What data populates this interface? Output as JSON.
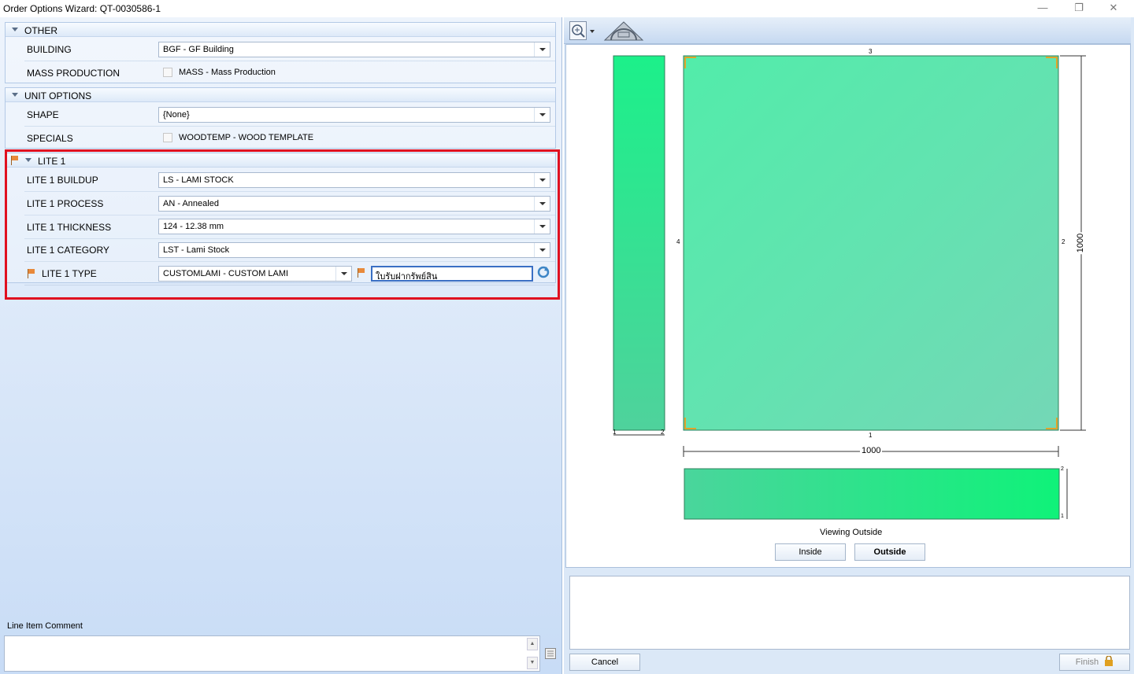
{
  "window": {
    "title": "Order Options Wizard: QT-0030586-1"
  },
  "groups": {
    "other": {
      "title": "OTHER",
      "building": {
        "label": "BUILDING",
        "value": "BGF - GF Building"
      },
      "mass_production": {
        "label": "MASS PRODUCTION",
        "checkbox_label": "MASS - Mass Production",
        "checked": false
      }
    },
    "unit_options": {
      "title": "UNIT OPTIONS",
      "shape": {
        "label": "SHAPE",
        "value": "{None}"
      },
      "specials": {
        "label": "SPECIALS",
        "checkbox_label": "WOODTEMP - WOOD TEMPLATE",
        "checked": false
      }
    },
    "lite1": {
      "title": "LITE 1",
      "buildup": {
        "label": "LITE 1 BUILDUP",
        "value": "LS - LAMI STOCK"
      },
      "process": {
        "label": "LITE 1 PROCESS",
        "value": "AN - Annealed"
      },
      "thickness": {
        "label": "LITE 1 THICKNESS",
        "value": "124 - 12.38 mm"
      },
      "category": {
        "label": "LITE 1 CATEGORY",
        "value": "LST - Lami Stock"
      },
      "type": {
        "label": "LITE 1 TYPE",
        "value": "CUSTOMLAMI - CUSTOM LAMI",
        "custom_text": "ใบรับฝากรัพย์สิน"
      }
    }
  },
  "comment": {
    "label": "Line Item Comment",
    "value": ""
  },
  "preview": {
    "top_number": "3",
    "left_number": "4",
    "right_number": "2",
    "bottom_number": "1",
    "width_dim": "1000",
    "height_dim": "1000",
    "side_left_labels": [
      "1",
      "2"
    ],
    "strip_labels": [
      "2",
      "1"
    ],
    "viewing_label": "Viewing Outside",
    "inside_label": "Inside",
    "outside_label": "Outside",
    "glass_color": "#5ae9a8",
    "accent_color": "#e01020"
  },
  "buttons": {
    "cancel": "Cancel",
    "finish": "Finish"
  }
}
